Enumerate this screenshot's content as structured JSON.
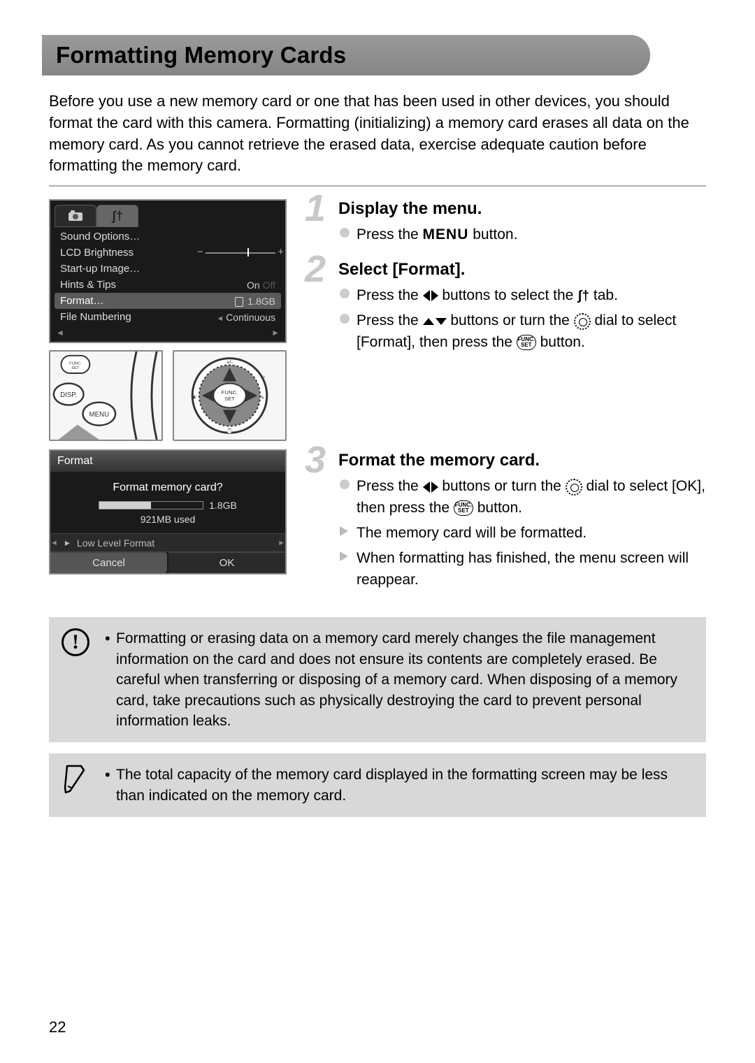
{
  "page_number": "22",
  "title": "Formatting Memory Cards",
  "intro": "Before you use a new memory card or one that has been used in other devices, you should format the card with this camera. Formatting (initializing) a memory card erases all data on the memory card. As you cannot retrieve the erased data, exercise adequate caution before formatting the memory card.",
  "menu_screen": {
    "rows": [
      {
        "label": "Sound Options…",
        "value": ""
      },
      {
        "label": "LCD Brightness",
        "slider": true
      },
      {
        "label": "Start-up Image…",
        "value": ""
      },
      {
        "label": "Hints & Tips",
        "value": "On",
        "value2": "Off"
      },
      {
        "label": "Format…",
        "value": "1.8GB",
        "highlight": true,
        "card_icon": true
      },
      {
        "label": "File Numbering",
        "value": "Continuous",
        "arrows": true
      }
    ]
  },
  "format_dialog": {
    "title": "Format",
    "question": "Format memory card?",
    "total": "1.8GB",
    "used": "921MB used",
    "low_level": "Low Level Format",
    "cancel": "Cancel",
    "ok": "OK"
  },
  "illus": {
    "disp": "DISP.",
    "menu": "MENU",
    "func": "FUNC.\nSET"
  },
  "steps": [
    {
      "num": "1",
      "title": "Display the menu.",
      "items": [
        {
          "type": "circle",
          "parts": [
            "Press the ",
            {
              "kind": "menu"
            },
            " button."
          ]
        }
      ]
    },
    {
      "num": "2",
      "title": "Select [Format].",
      "items": [
        {
          "type": "circle",
          "parts": [
            "Press the ",
            {
              "kind": "lr"
            },
            " buttons to select the ",
            {
              "kind": "tools"
            },
            " tab."
          ]
        },
        {
          "type": "circle",
          "parts": [
            "Press the ",
            {
              "kind": "ud"
            },
            " buttons or turn the ",
            {
              "kind": "dial"
            },
            " dial to select [Format], then press the ",
            {
              "kind": "func"
            },
            " button."
          ]
        }
      ]
    },
    {
      "num": "3",
      "title": "Format the memory card.",
      "items": [
        {
          "type": "circle",
          "parts": [
            "Press the ",
            {
              "kind": "lr"
            },
            " buttons or turn the ",
            {
              "kind": "dial"
            },
            " dial to select [OK], then press the ",
            {
              "kind": "func"
            },
            " button."
          ]
        },
        {
          "type": "tri",
          "parts": [
            "The memory card will be formatted."
          ]
        },
        {
          "type": "tri",
          "parts": [
            "When formatting has finished, the menu screen will reappear."
          ]
        }
      ]
    }
  ],
  "caution_note": "Formatting or erasing data on a memory card merely changes the file management information on the card and does not ensure its contents are completely erased. Be careful when transferring or disposing of a memory card. When disposing of a memory card, take precautions such as physically destroying the card to prevent personal information leaks.",
  "capacity_note": "The total capacity of the memory card displayed in the formatting screen may be less than indicated on the memory card."
}
